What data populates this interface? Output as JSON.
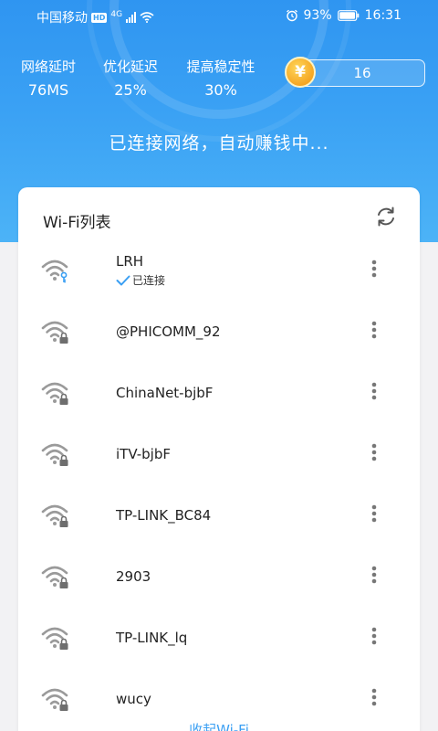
{
  "status_bar": {
    "carrier": "中国移动",
    "hd_badge": "HD",
    "network_type": "4G",
    "battery": "93%",
    "time": "16:31"
  },
  "stats": [
    {
      "label": "网络延时",
      "value": "76MS"
    },
    {
      "label": "优化延迟",
      "value": "25%"
    },
    {
      "label": "提高稳定性",
      "value": "30%"
    }
  ],
  "coins": {
    "symbol": "¥",
    "amount": "16"
  },
  "banner": "已连接网络，自动赚钱中...",
  "wifi_list": {
    "title": "Wi-Fi列表",
    "items": [
      {
        "ssid": "LRH",
        "status": "已连接",
        "icon": "wifi-key-icon"
      },
      {
        "ssid": "@PHICOMM_92",
        "status": "",
        "icon": "wifi-lock-icon"
      },
      {
        "ssid": "ChinaNet-bjbF",
        "status": "",
        "icon": "wifi-lock-icon"
      },
      {
        "ssid": "iTV-bjbF",
        "status": "",
        "icon": "wifi-lock-icon"
      },
      {
        "ssid": "TP-LINK_BC84",
        "status": "",
        "icon": "wifi-lock-icon"
      },
      {
        "ssid": "2903",
        "status": "",
        "icon": "wifi-lock-icon"
      },
      {
        "ssid": "TP-LINK_lq",
        "status": "",
        "icon": "wifi-lock-icon"
      },
      {
        "ssid": "wucy",
        "status": "",
        "icon": "wifi-lock-icon"
      }
    ]
  },
  "collapse_label": "收起Wi-Fi",
  "colors": {
    "accent": "#3a9ff3",
    "coin": "#f5a623",
    "header": "#2f95f1"
  }
}
